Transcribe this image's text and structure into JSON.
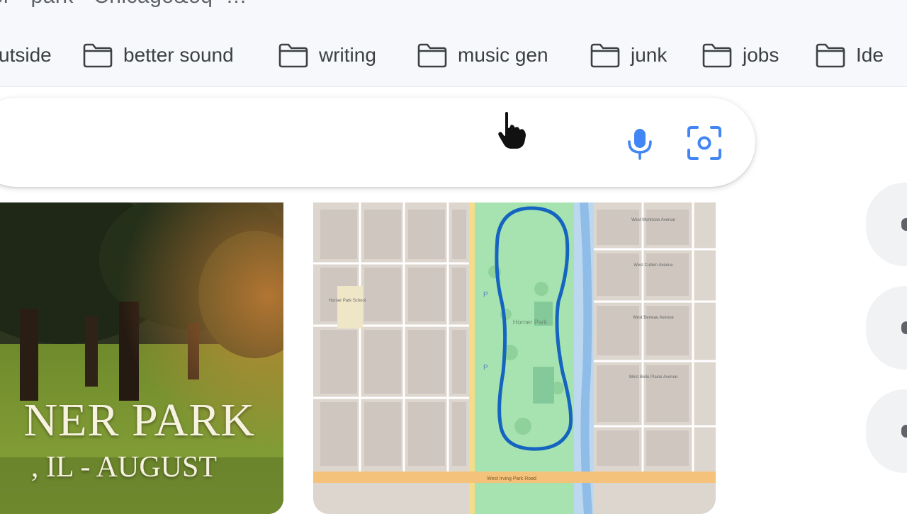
{
  "url_bar": {
    "text": "rner · park · Chicago&oq=…"
  },
  "bookmarks": [
    {
      "label": "utside",
      "icon": "folder-icon"
    },
    {
      "label": "better sound",
      "icon": "folder-icon"
    },
    {
      "label": "writing",
      "icon": "folder-icon"
    },
    {
      "label": "music gen",
      "icon": "folder-icon"
    },
    {
      "label": "junk",
      "icon": "folder-icon"
    },
    {
      "label": "jobs",
      "icon": "folder-icon"
    },
    {
      "label": "Ide",
      "icon": "folder-icon"
    }
  ],
  "search": {
    "value": "",
    "mic_icon": "microphone-icon",
    "lens_icon": "camera-lens-icon",
    "accent": "#4285f4"
  },
  "results": {
    "photo_title": "NER PARK",
    "photo_subtitle": ", IL - AUGUST",
    "map_label_park": "Horner Park",
    "map_label_school": "Horner Park School",
    "map_street_labels": [
      "West Montrose Avenue",
      "West Cullom Avenue",
      "West Berteau Avenue",
      "West Belle Plaine Avenue",
      "West Irving Park Road"
    ],
    "map_marker_p": "P",
    "route_color": "#1565c0"
  }
}
